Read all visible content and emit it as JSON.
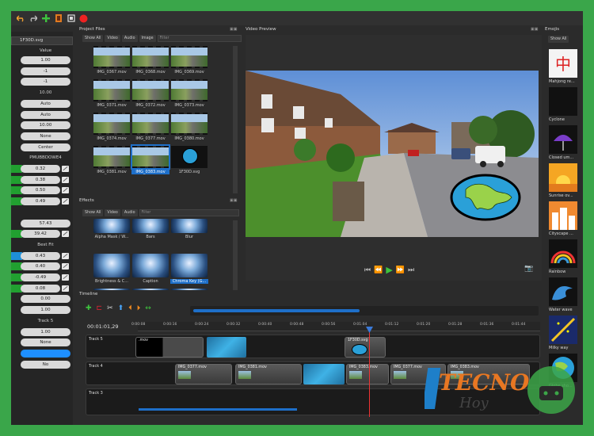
{
  "colors": {
    "accent_green": "#21a030",
    "accent_blue": "#1e8fff",
    "record_red": "#e22",
    "frame_green": "#3aa64a"
  },
  "toolbar": {
    "icons": [
      "undo-icon",
      "redo-icon",
      "add-icon",
      "film-icon",
      "fullscreen-icon",
      "record-icon"
    ]
  },
  "properties": {
    "selected": "1F30D.svg",
    "value_header": "Value",
    "rows": [
      {
        "value": "1.00",
        "style": "pill"
      },
      {
        "value": "-1",
        "style": "pill"
      },
      {
        "value": "-1",
        "style": "pill"
      },
      {
        "value": "10.00",
        "style": "plain"
      },
      {
        "value": "Auto",
        "style": "pill"
      },
      {
        "value": "Auto",
        "style": "pill"
      },
      {
        "value": "10.00",
        "style": "pill"
      },
      {
        "value": "None",
        "style": "pill"
      },
      {
        "value": "Center",
        "style": "pill"
      },
      {
        "value": "PMUBBDOWE4",
        "style": "plain"
      },
      {
        "value": "0.32",
        "style": "green"
      },
      {
        "value": "0.38",
        "style": "green"
      },
      {
        "value": "0.50",
        "style": "green"
      },
      {
        "value": "0.49",
        "style": "green"
      },
      {
        "value": "",
        "style": "empty"
      },
      {
        "value": "57.43",
        "style": "pill"
      },
      {
        "value": "39.42",
        "style": "green"
      },
      {
        "value": "Best Fit",
        "style": "plain"
      },
      {
        "value": "0.43",
        "style": "blue"
      },
      {
        "value": "0.40",
        "style": "green"
      },
      {
        "value": "-0.49",
        "style": "green"
      },
      {
        "value": "0.08",
        "style": "green"
      },
      {
        "value": "0.00",
        "style": "pill"
      },
      {
        "value": "1.00",
        "style": "pill"
      },
      {
        "value": "Track 5",
        "style": "plain"
      },
      {
        "value": "1.00",
        "style": "pill"
      },
      {
        "value": "None",
        "style": "pill"
      },
      {
        "value": "",
        "style": "bluepill"
      },
      {
        "value": "No",
        "style": "pill"
      }
    ]
  },
  "project_files": {
    "title": "Project Files",
    "filters": [
      "Show All",
      "Video",
      "Audio",
      "Image"
    ],
    "filter_placeholder": "Filter",
    "files": [
      "IMG_0367.mov",
      "IMG_0368.mov",
      "IMG_0369.mov",
      "IMG_0371.mov",
      "IMG_0372.mov",
      "IMG_0373.mov",
      "IMG_0374.mov",
      "IMG_0377.mov",
      "IMG_0380.mov",
      "IMG_0381.mov",
      "IMG_0383.mov",
      "1F30D.svg"
    ]
  },
  "effects": {
    "title": "Effects",
    "filters": [
      "Show All",
      "Video",
      "Audio"
    ],
    "filter_placeholder": "Filter",
    "items": [
      "Alpha Mask / W...",
      "Bars",
      "Blur",
      "Brightness & C...",
      "Caption",
      "Chroma Key (G..."
    ]
  },
  "preview": {
    "title": "Video Preview"
  },
  "emojis": {
    "title": "Emojis",
    "filter": "Show All",
    "filter_placeholder": "Filter",
    "items": [
      "Mahjong re...",
      "Cyclone",
      "Closed um...",
      "Sunrise ov...",
      "Cityscape ...",
      "Rainbow",
      "Water wave",
      "Milky way",
      "Globe sho..."
    ]
  },
  "timeline": {
    "title": "Timeline",
    "timecode": "00:01:01,29",
    "ticks": [
      "0:00:08",
      "0:00:16",
      "0:00:24",
      "0:00:32",
      "0:00:40",
      "0:00:48",
      "0:00:56",
      "0:01:04",
      "0:01:12",
      "0:01:20",
      "0:01:28",
      "0:01:36",
      "0:01:44"
    ],
    "tracks": [
      {
        "name": "Track 5",
        "clips": [
          ".mov",
          "1F30D.svg"
        ]
      },
      {
        "name": "Track 4",
        "clips": [
          "IMG_0377.mov",
          "IMG_0381.mov",
          "IMG_0383.mov",
          "IMG_0377.mov",
          "IMG_0383.mov"
        ]
      },
      {
        "name": "Track 3",
        "clips": []
      }
    ]
  },
  "watermark": {
    "brand": "TECNO",
    "sub": "Hoy"
  }
}
